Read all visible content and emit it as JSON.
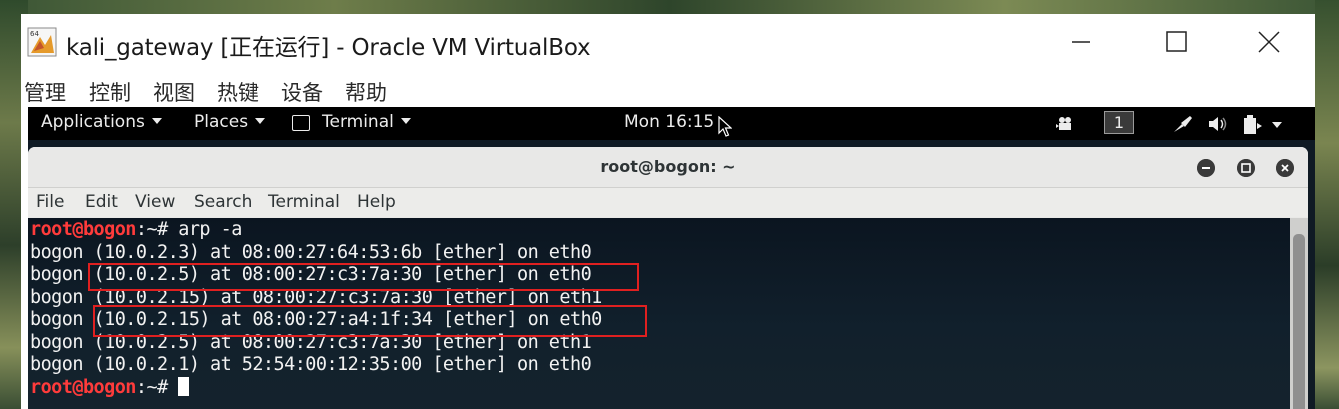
{
  "window": {
    "title": "kali_gateway [正在运行] - Oracle VM VirtualBox",
    "icon": "virtualbox-64-icon",
    "controls": {
      "minimize": "minimize-icon",
      "maximize": "maximize-icon",
      "close": "close-icon"
    }
  },
  "vbox_menu": [
    "管理",
    "控制",
    "视图",
    "热键",
    "设备",
    "帮助"
  ],
  "gnome_panel": {
    "applications": "Applications",
    "places": "Places",
    "terminal": "Terminal",
    "clock": "Mon 16:15",
    "workspace": "1",
    "tray_icons": [
      "video-icon",
      "network-icon",
      "volume-icon",
      "battery-icon",
      "power-menu-icon"
    ]
  },
  "terminal": {
    "title": "root@bogon: ~",
    "menu": [
      "File",
      "Edit",
      "View",
      "Search",
      "Terminal",
      "Help"
    ],
    "prompt_user": "root@bogon",
    "prompt_suffix": ":~# ",
    "command": "arp -a",
    "output": [
      "bogon (10.0.2.3) at 08:00:27:64:53:6b [ether] on eth0",
      "bogon (10.0.2.5) at 08:00:27:c3:7a:30 [ether] on eth0",
      "bogon (10.0.2.15) at 08:00:27:c3:7a:30 [ether] on eth1",
      "bogon (10.0.2.15) at 08:00:27:a4:1f:34 [ether] on eth0",
      "bogon (10.0.2.5) at 08:00:27:c3:7a:30 [ether] on eth1",
      "bogon (10.0.2.1) at 52:54:00:12:35:00 [ether] on eth0"
    ],
    "highlighted_rows": [
      1,
      3
    ]
  },
  "colors": {
    "prompt": "#ff3b3b",
    "highlight_box": "#e02020",
    "terminal_bg": "#0f1a24",
    "panel_bg": "#000000"
  }
}
